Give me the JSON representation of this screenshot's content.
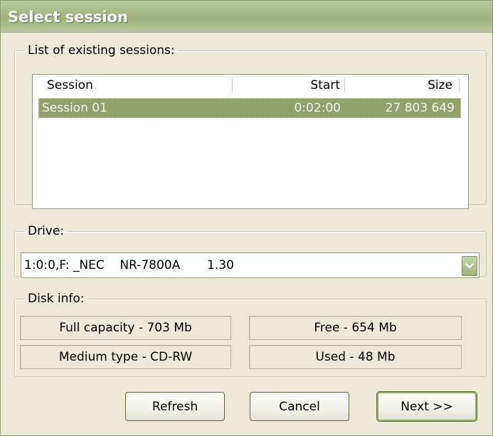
{
  "window": {
    "title": "Select session"
  },
  "sessions": {
    "legend": "List of existing sessions:",
    "columns": {
      "session": "Session",
      "start": "Start",
      "size": "Size"
    },
    "rows": [
      {
        "session": "Session 01",
        "start": "0:02:00",
        "size": "27 803 649"
      }
    ]
  },
  "drive": {
    "legend": "Drive:",
    "selected": "1:0:0,F: _NEC    NR-7800A       1.30"
  },
  "disk_info": {
    "legend": "Disk info:",
    "full_capacity": "Full capacity - 703 Mb",
    "free": "Free - 654 Mb",
    "medium_type": "Medium type - CD-RW",
    "used": "Used - 48 Mb"
  },
  "buttons": {
    "refresh": "Refresh",
    "cancel": "Cancel",
    "next": "Next >>"
  },
  "colors": {
    "selection": "#92a06b",
    "title_bar": "#a7ba86",
    "dialog_bg": "#ece9d8",
    "accent_border": "#8ea36b"
  },
  "icons": {
    "dropdown": "chevron-down-icon"
  }
}
